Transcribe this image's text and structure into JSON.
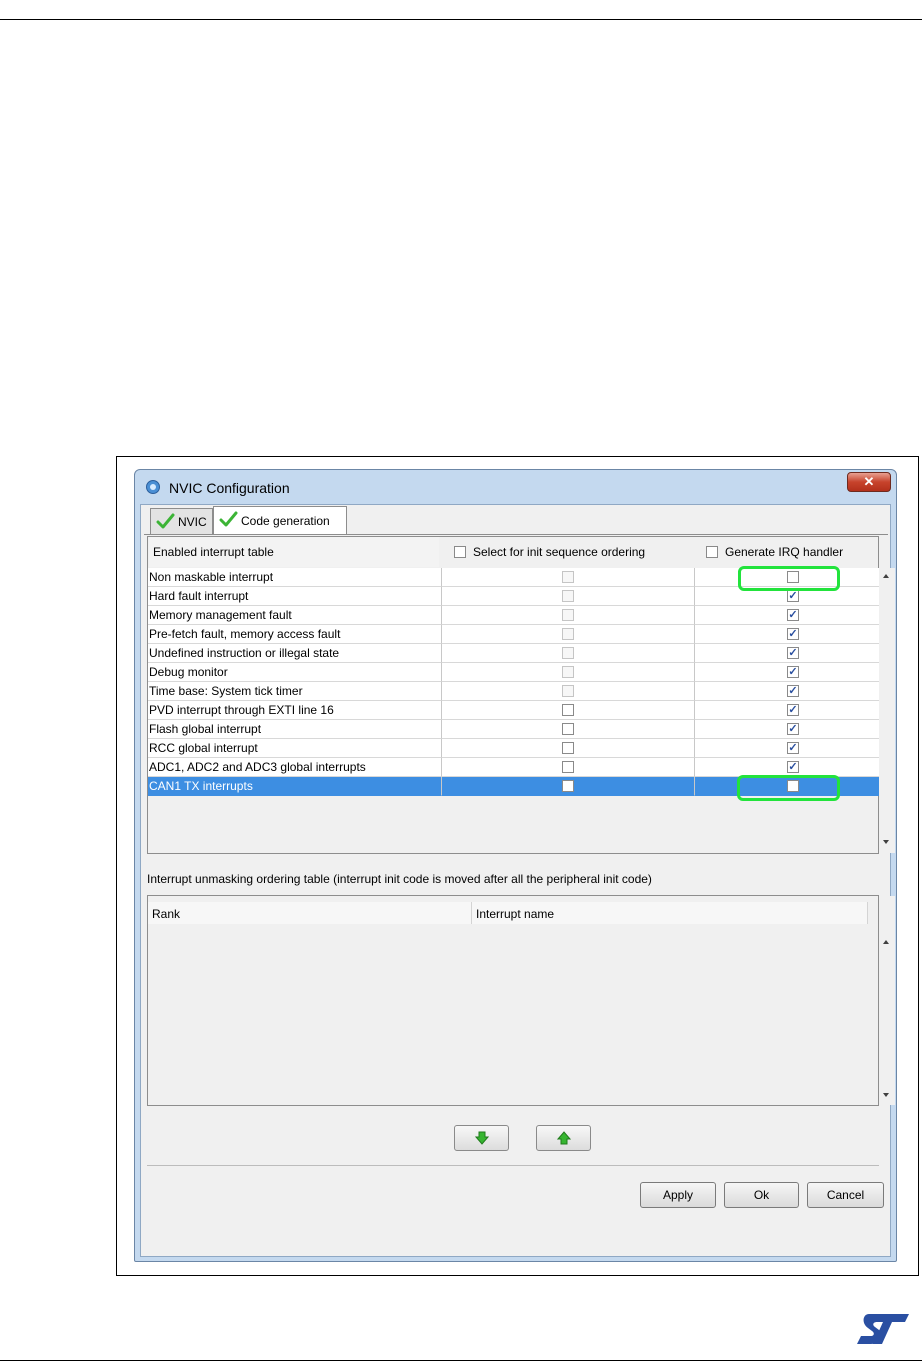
{
  "window": {
    "title": "NVIC Configuration",
    "close_glyph": "✕"
  },
  "tabs": [
    {
      "label": "NVIC",
      "icon": "green-check-icon"
    },
    {
      "label": "Code generation",
      "icon": "green-check-icon",
      "active": true
    }
  ],
  "upper_table": {
    "header": {
      "col1": "Enabled interrupt table",
      "col2": "Select for init sequence ordering",
      "col3": "Generate IRQ handler"
    },
    "rows": [
      {
        "name": "Non maskable interrupt",
        "init_seq": "disabled",
        "irq_handler": false
      },
      {
        "name": "Hard fault interrupt",
        "init_seq": "disabled",
        "irq_handler": true
      },
      {
        "name": "Memory management fault",
        "init_seq": "disabled",
        "irq_handler": true
      },
      {
        "name": "Pre-fetch fault, memory access fault",
        "init_seq": "disabled",
        "irq_handler": true
      },
      {
        "name": "Undefined instruction or illegal state",
        "init_seq": "disabled",
        "irq_handler": true
      },
      {
        "name": "Debug monitor",
        "init_seq": "disabled",
        "irq_handler": true
      },
      {
        "name": "Time base: System tick timer",
        "init_seq": "disabled",
        "irq_handler": true
      },
      {
        "name": "PVD interrupt through EXTI line 16",
        "init_seq": "unchecked",
        "irq_handler": true
      },
      {
        "name": "Flash global interrupt",
        "init_seq": "unchecked",
        "irq_handler": true
      },
      {
        "name": "RCC global interrupt",
        "init_seq": "unchecked",
        "irq_handler": true
      },
      {
        "name": "ADC1, ADC2 and ADC3 global interrupts",
        "init_seq": "unchecked",
        "irq_handler": true
      },
      {
        "name": "CAN1 TX interrupts",
        "init_seq": "unchecked",
        "irq_handler": false,
        "selected": true
      }
    ]
  },
  "lower_section": {
    "label": "Interrupt unmasking ordering table (interrupt init code is moved after all the peripheral init code)",
    "columns": [
      "Rank",
      "Interrupt name"
    ]
  },
  "move_buttons": [
    {
      "icon": "green-arrow-down-icon"
    },
    {
      "icon": "green-arrow-up-icon"
    }
  ],
  "buttons": {
    "apply": "Apply",
    "ok": "Ok",
    "cancel": "Cancel"
  },
  "colors": {
    "selection": "#3d8ee2",
    "highlight": "#22e33c",
    "window_frame": "#c4d9ef"
  },
  "logo": {
    "text": "ST",
    "icon": "st-logo"
  }
}
